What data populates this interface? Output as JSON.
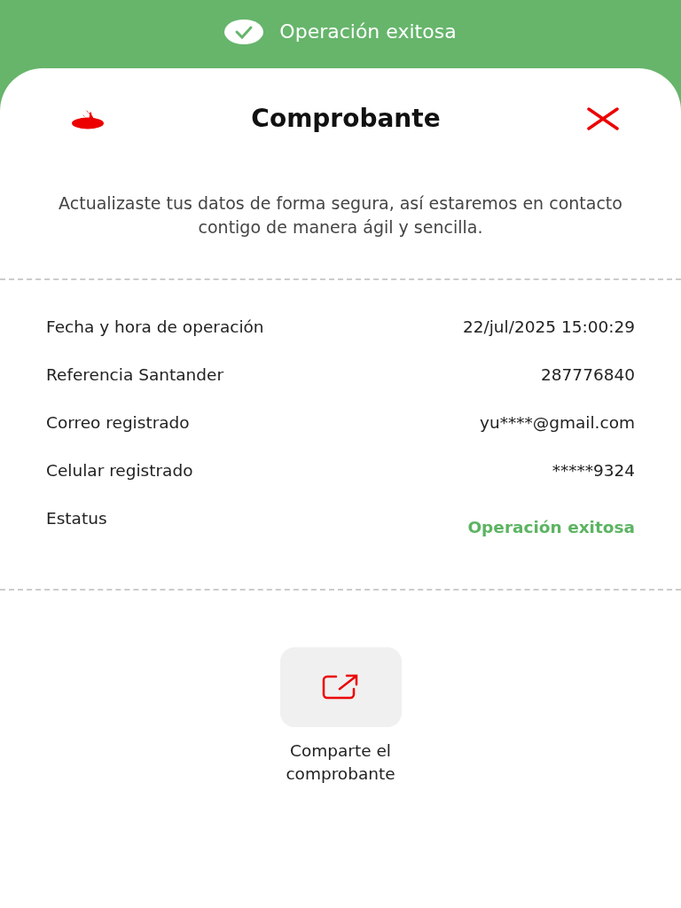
{
  "banner": {
    "text": "Operación exitosa"
  },
  "header": {
    "title": "Comprobante"
  },
  "message": "Actualizaste tus datos de forma segura, así estaremos en contacto contigo de manera ágil y sencilla.",
  "details": [
    {
      "kind": "plain",
      "label": "Fecha y hora de operación",
      "value": "22/jul/2025 15:00:29"
    },
    {
      "kind": "plain",
      "label": "Referencia Santander",
      "value": "287776840"
    },
    {
      "kind": "plain",
      "label": "Correo registrado",
      "value": "yu****@gmail.com"
    },
    {
      "kind": "plain",
      "label": "Celular registrado",
      "value": "*****9324"
    },
    {
      "kind": "status",
      "label": "Estatus",
      "value": "Operación exitosa"
    }
  ],
  "share": {
    "label": "Comparte el comprobante"
  }
}
